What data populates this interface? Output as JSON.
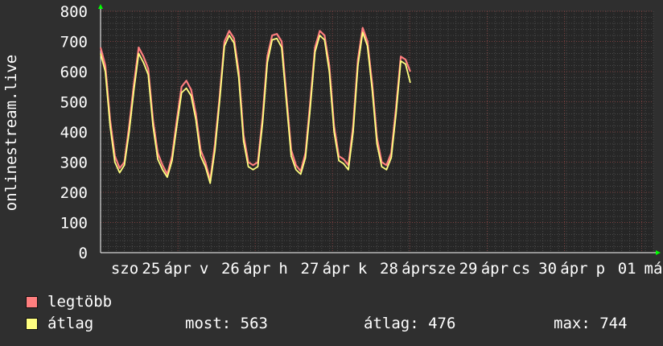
{
  "chart_data": {
    "type": "line",
    "ylabel": "onlinestream.live",
    "ylim": [
      0,
      800
    ],
    "yticks": [
      0,
      100,
      200,
      300,
      400,
      500,
      600,
      700,
      800
    ],
    "xlabels": [
      "szo",
      "25",
      "ápr",
      "v",
      "26",
      "ápr",
      "h",
      "27",
      "ápr",
      "k",
      "28",
      "ápr",
      "sze",
      "29",
      "ápr",
      "cs",
      "30",
      "ápr",
      "p",
      "01",
      "má"
    ],
    "grid": true,
    "x": [
      0,
      0.25,
      0.5,
      0.75,
      1,
      1.25,
      1.5,
      1.75,
      2,
      2.25,
      2.5,
      2.75,
      3,
      3.25,
      3.5,
      3.75,
      4,
      4.25,
      4.5,
      4.75,
      5,
      5.25,
      5.5,
      5.75,
      6,
      6.25,
      6.5,
      6.75,
      7,
      7.25,
      7.5,
      7.75,
      8,
      8.25,
      8.5,
      8.75,
      9,
      9.25,
      9.5,
      9.75,
      10,
      10.25,
      10.5,
      10.75,
      11,
      11.25,
      11.5,
      11.75,
      12,
      12.25,
      12.5,
      12.75,
      13,
      13.25,
      13.5,
      13.75,
      14,
      14.25,
      14.5,
      14.75,
      15,
      15.25,
      15.5,
      15.75,
      16,
      16.25,
      16.5,
      16.75,
      17,
      17.25,
      17.5,
      17.75,
      18,
      18.25,
      18.5,
      18.75,
      19,
      19.25,
      19.5,
      19.75,
      20,
      20.25,
      20.5,
      20.75,
      21,
      21.25,
      21.5,
      21.75,
      22,
      22.25,
      22.5,
      22.75,
      23,
      23.25,
      23.5,
      23.75,
      24,
      24.25,
      24.5,
      24.75,
      25,
      25.25,
      25.5,
      25.75,
      26,
      26.25,
      26.5,
      26.75,
      27,
      27.25,
      27.5,
      27.75,
      28,
      28.25,
      28.5,
      28.75,
      29
    ],
    "series": [
      {
        "name": "legtöbb",
        "color": "#ff7f7f",
        "values": [
          680,
          620,
          440,
          320,
          280,
          300,
          420,
          560,
          680,
          650,
          610,
          440,
          330,
          290,
          260,
          320,
          440,
          550,
          570,
          540,
          460,
          340,
          300,
          240,
          360,
          520,
          700,
          735,
          710,
          600,
          390,
          300,
          290,
          300,
          450,
          650,
          720,
          725,
          700,
          520,
          340,
          290,
          270,
          330,
          500,
          680,
          735,
          720,
          620,
          420,
          320,
          310,
          290,
          420,
          640,
          745,
          700,
          560,
          380,
          300,
          290,
          330,
          480,
          650,
          640,
          600
        ]
      },
      {
        "name": "átlag",
        "color": "#ffff80",
        "values": [
          660,
          600,
          420,
          300,
          265,
          290,
          400,
          540,
          660,
          630,
          590,
          420,
          310,
          275,
          250,
          305,
          420,
          530,
          545,
          520,
          440,
          320,
          285,
          230,
          340,
          505,
          685,
          720,
          695,
          580,
          370,
          285,
          275,
          285,
          430,
          630,
          705,
          710,
          680,
          500,
          320,
          275,
          260,
          315,
          480,
          665,
          720,
          705,
          600,
          400,
          305,
          295,
          275,
          400,
          620,
          730,
          685,
          540,
          360,
          285,
          275,
          315,
          460,
          635,
          625,
          563
        ]
      }
    ]
  },
  "legend": [
    {
      "label": "legtöbb",
      "color": "#ff7f7f"
    },
    {
      "label": "átlag",
      "color": "#ffff80"
    }
  ],
  "stats": {
    "most": "most: 563",
    "atlag": "átlag: 476",
    "max": "max: 744"
  }
}
